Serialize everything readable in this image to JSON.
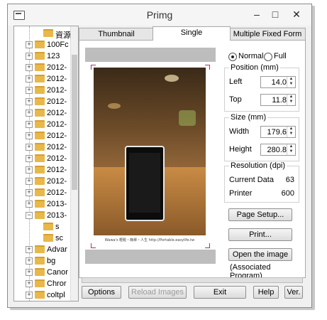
{
  "window": {
    "title": "Primg"
  },
  "tree": {
    "items": [
      {
        "label": "資源回",
        "level": 1,
        "expander": ""
      },
      {
        "label": "100Fc",
        "level": 0,
        "expander": "+"
      },
      {
        "label": "123",
        "level": 0,
        "expander": "+"
      },
      {
        "label": "2012-",
        "level": 0,
        "expander": "+"
      },
      {
        "label": "2012-",
        "level": 0,
        "expander": "+"
      },
      {
        "label": "2012-",
        "level": 0,
        "expander": "+"
      },
      {
        "label": "2012-",
        "level": 0,
        "expander": "+"
      },
      {
        "label": "2012-",
        "level": 0,
        "expander": "+"
      },
      {
        "label": "2012-",
        "level": 0,
        "expander": "+"
      },
      {
        "label": "2012-",
        "level": 0,
        "expander": "+"
      },
      {
        "label": "2012-",
        "level": 0,
        "expander": "+"
      },
      {
        "label": "2012-",
        "level": 0,
        "expander": "+"
      },
      {
        "label": "2012-",
        "level": 0,
        "expander": "+"
      },
      {
        "label": "2012-",
        "level": 0,
        "expander": "+"
      },
      {
        "label": "2012-",
        "level": 0,
        "expander": "+"
      },
      {
        "label": "2013-",
        "level": 0,
        "expander": "+"
      },
      {
        "label": "2013-",
        "level": 0,
        "expander": "−"
      },
      {
        "label": "s",
        "level": 1,
        "expander": ""
      },
      {
        "label": "sc",
        "level": 1,
        "expander": ""
      },
      {
        "label": "Advar",
        "level": 0,
        "expander": "+"
      },
      {
        "label": "bg",
        "level": 0,
        "expander": "+"
      },
      {
        "label": "Canor",
        "level": 0,
        "expander": "+"
      },
      {
        "label": "Chror",
        "level": 0,
        "expander": "+"
      },
      {
        "label": "coltpl",
        "level": 0,
        "expander": "+"
      }
    ]
  },
  "tabs": [
    {
      "label": "Thumbnail",
      "active": false
    },
    {
      "label": "Single",
      "active": true
    },
    {
      "label": "Multiple Fixed Form",
      "active": false
    }
  ],
  "preview": {
    "caption": "Wawa's 輕鬆・簡單・人生  http://Portable.easylife.tw"
  },
  "mode": {
    "normal_label": "Normal",
    "full_label": "Full",
    "selected": "Normal"
  },
  "position": {
    "title": "Position (mm)",
    "left_label": "Left",
    "left_value": "14.0",
    "top_label": "Top",
    "top_value": "11.8"
  },
  "size": {
    "title": "Size (mm)",
    "width_label": "Width",
    "width_value": "179.6",
    "height_label": "Height",
    "height_value": "280.8"
  },
  "resolution": {
    "title": "Resolution (dpi)",
    "current_label": "Current Data",
    "current_value": "63",
    "printer_label": "Printer",
    "printer_value": "600"
  },
  "actions": {
    "page_setup": "Page Setup...",
    "print": "Print...",
    "open_image": "Open the image",
    "associated": "(Associated Program)"
  },
  "footer": {
    "options": "Options",
    "reload": "Reload Images",
    "exit": "Exit",
    "help": "Help",
    "ver": "Ver."
  }
}
